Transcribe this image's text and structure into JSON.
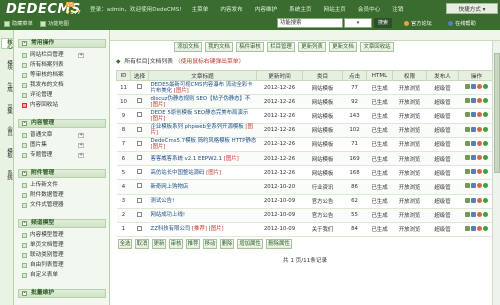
{
  "app": {
    "logo": "DEDECMS",
    "badge": "V5",
    "version": "v5.7"
  },
  "topnav": {
    "welcome": "登录：admin，欢迎使用DedeCMS!",
    "items": [
      "主菜单",
      "内容发布",
      "内容维护",
      "系统主页",
      "网站主页",
      "会员中心",
      "注销"
    ]
  },
  "quick_menu": "快捷方式 ▾",
  "header_tools": [
    {
      "label": "隐藏菜单"
    },
    {
      "label": "功能地图"
    }
  ],
  "search": {
    "value": "功能搜索",
    "select": "▾",
    "button": "搜索"
  },
  "header_links": [
    {
      "label": "官方论坛",
      "color": "#e8a33d"
    },
    {
      "label": "在线帮助",
      "color": "#5a7fb4"
    }
  ],
  "vtabs": [
    "核心",
    "模块",
    "生成",
    "采集",
    "会员",
    "模板",
    "系统"
  ],
  "menu": {
    "groups": [
      {
        "title": "常用操作",
        "items": [
          {
            "label": "网站栏目管理",
            "plus": "+"
          },
          {
            "label": "所有档案列表"
          },
          {
            "label": "等审核的档案"
          },
          {
            "label": "我发布的文档"
          },
          {
            "label": "评论管理"
          },
          {
            "label": "内容回收站",
            "hot": true
          }
        ]
      },
      {
        "title": "内容管理",
        "items": [
          {
            "label": "普通文章",
            "plus": "+"
          },
          {
            "label": "图片集",
            "plus": "+"
          },
          {
            "label": "专题管理",
            "plus": "+"
          }
        ]
      },
      {
        "title": "附件管理",
        "items": [
          {
            "label": "上传新文件"
          },
          {
            "label": "附件数据管理"
          },
          {
            "label": "文件式管理器"
          }
        ]
      },
      {
        "title": "频道模型",
        "items": [
          {
            "label": "内容模型管理"
          },
          {
            "label": "单页文档管理"
          },
          {
            "label": "联动类别管理"
          },
          {
            "label": "自由列表管理"
          },
          {
            "label": "自定义表单"
          }
        ]
      },
      {
        "title": "批量维护",
        "items": []
      }
    ]
  },
  "actions": [
    "添加文档",
    "我的文档",
    "稿件审核",
    "栏目管理",
    "更新列表",
    "更新文档",
    "文章回收站"
  ],
  "list_title": "所有栏目[文档列表",
  "list_note": "（使用鼠标右键弹出菜单）",
  "table": {
    "headers": [
      "ID",
      "选择",
      "文章标题",
      "更新时间",
      "类目",
      "点击",
      "HTML",
      "权限",
      "发布人",
      "操作"
    ],
    "rows": [
      {
        "id": "11",
        "title": "DEDE5最新可视CMS内容瀑布 流动全彩卡片布美化",
        "flag": "[图片]",
        "date": "2012-12-26",
        "cat": "网站模板",
        "hits": "77",
        "html": "已生成",
        "perm": "开放浏览",
        "author": "超级管"
      },
      {
        "id": "10",
        "title": "discuz伪静态规则 SEO【帖子伪静态】不",
        "flag": "[图片]",
        "date": "2012-12-26",
        "cat": "网站模板",
        "hits": "92",
        "html": "已生成",
        "perm": "开放浏览",
        "author": "超级管"
      },
      {
        "id": "9",
        "title": "DEDE 5原创模板 SEO静态完美布局演示",
        "flag": "[图片]",
        "date": "2012-12-26",
        "cat": "网站模板",
        "hits": "143",
        "html": "已生成",
        "perm": "开放浏览",
        "author": "超级管"
      },
      {
        "id": "8",
        "title": "企业模板系列 phpweb全系列开源模板",
        "flag": "[图片]",
        "date": "2012-12-26",
        "cat": "网站模板",
        "hits": "102",
        "html": "已生成",
        "perm": "开放浏览",
        "author": "超级管"
      },
      {
        "id": "7",
        "title": "DedeCms5.7模板 简约风格模板 HTTP静态",
        "flag": "[图片]",
        "date": "2012-12-26",
        "cat": "网站模板",
        "hits": "71",
        "html": "已生成",
        "perm": "开放浏览",
        "author": "超级管"
      },
      {
        "id": "6",
        "title": "客客威客系统 v2.1 EEPW2.1",
        "flag": "[图片]",
        "date": "2012-12-26",
        "cat": "网站模板",
        "hits": "169",
        "html": "已生成",
        "perm": "开放浏览",
        "author": "超级管"
      },
      {
        "id": "5",
        "title": "高仿站长中国整站源码",
        "flag": "[图片]",
        "date": "2012-12-26",
        "cat": "网站模板",
        "hits": "168",
        "html": "已生成",
        "perm": "开放浏览",
        "author": "超级管"
      },
      {
        "id": "4",
        "title": "新奇网上购物店",
        "flag": "",
        "date": "2012-10-20",
        "cat": "行业资讯",
        "hits": "86",
        "html": "已生成",
        "perm": "开放浏览",
        "author": "超级管"
      },
      {
        "id": "3",
        "title": "测试公告!",
        "flag": "",
        "date": "2012-10-09",
        "cat": "官方公告",
        "hits": "62",
        "html": "已生成",
        "perm": "开放浏览",
        "author": "超级管"
      },
      {
        "id": "2",
        "title": "网站成功上线!",
        "flag": "",
        "date": "2012-10-09",
        "cat": "官方公告",
        "hits": "55",
        "html": "已生成",
        "perm": "开放浏览",
        "author": "超级管"
      },
      {
        "id": "1",
        "title": "ZZ科技有限公司",
        "flag": "[推荐] [图片]",
        "date": "2012-10-09",
        "cat": "关于我们",
        "hits": "84",
        "html": "已生成",
        "perm": "开放浏览",
        "author": "超级管"
      }
    ]
  },
  "bottom_actions": [
    "全选",
    "取消",
    "更新",
    "审核",
    "推荐",
    "移动",
    "删除",
    "增加属性",
    "删除属性"
  ],
  "pager": "共 1 页/11条记录"
}
